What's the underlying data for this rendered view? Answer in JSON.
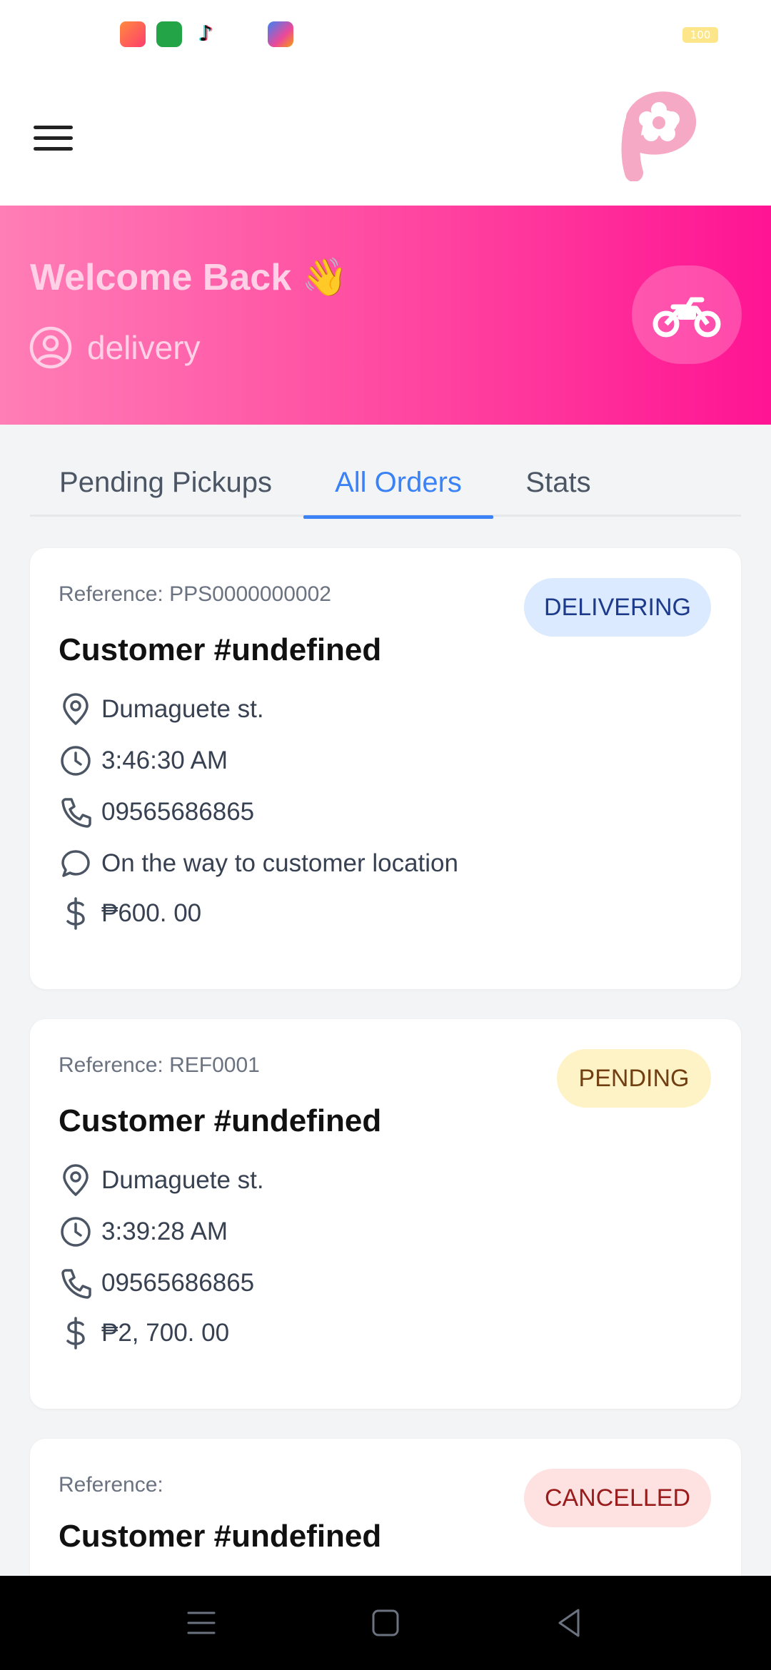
{
  "status_bar": {
    "battery": "100",
    "icons": [
      "game-app-icon",
      "app-store-icon",
      "tiktok-icon",
      "star-app-icon"
    ]
  },
  "header": {
    "menu_icon": "hamburger-menu-icon",
    "logo_icon": "flower-p-logo"
  },
  "hero": {
    "greeting": "Welcome Back 👋",
    "user_icon": "user-circle-icon",
    "role": "delivery",
    "vehicle_icon": "motorcycle-icon"
  },
  "tabs": [
    {
      "label": "Pending Pickups",
      "active": false
    },
    {
      "label": "All Orders",
      "active": true
    },
    {
      "label": "Stats",
      "active": false
    }
  ],
  "orders": [
    {
      "reference": "Reference: PPS0000000002",
      "customer": "Customer #undefined",
      "status": "DELIVERING",
      "address": "Dumaguete st.",
      "time": "3:46:30 AM",
      "phone": "09565686865",
      "note": "On the way to customer location",
      "amount": "₱600. 00"
    },
    {
      "reference": "Reference: REF0001",
      "customer": "Customer #undefined",
      "status": "PENDING",
      "address": "Dumaguete st.",
      "time": "3:39:28 AM",
      "phone": "09565686865",
      "amount": "₱2, 700. 00"
    },
    {
      "reference": "Reference:",
      "customer": "Customer #undefined",
      "status": "CANCELLED"
    }
  ],
  "colors": {
    "accent_pink": "#ff1493",
    "tab_active": "#3b82f6",
    "delivering_bg": "#dbeafe",
    "pending_bg": "#fef3c7",
    "cancelled_bg": "#fee2e2"
  },
  "nav": {
    "icons": [
      "recent-apps-icon",
      "home-icon",
      "back-icon"
    ]
  }
}
